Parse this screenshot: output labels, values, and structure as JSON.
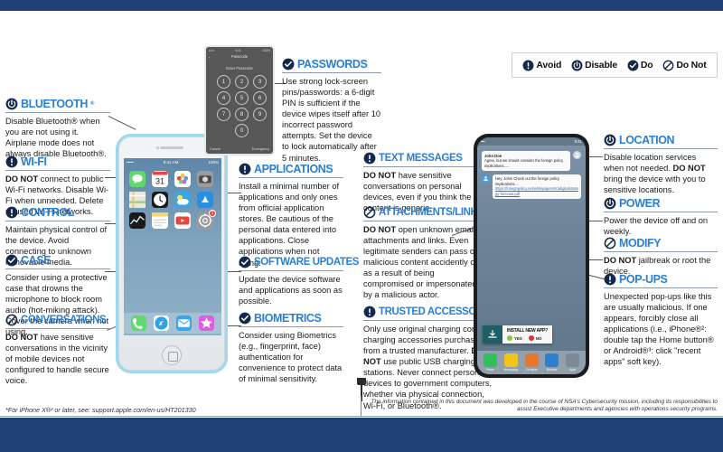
{
  "legend": {
    "items": [
      {
        "icon": "exclamation-icon",
        "label": "Avoid"
      },
      {
        "icon": "power-icon",
        "label": "Disable"
      },
      {
        "icon": "check-icon",
        "label": "Do"
      },
      {
        "icon": "prohibition-icon",
        "label": "Do Not"
      }
    ]
  },
  "sections": {
    "bluetooth": {
      "title": "BLUETOOTH",
      "sup": "®",
      "icon": "power-icon",
      "body": "Disable Bluetooth® when you are not using it. Airplane mode does not always disable Bluetooth®."
    },
    "wifi": {
      "title": "WI-FI",
      "icon": "exclamation-icon",
      "body_bold": "DO NOT",
      "body": " connect to public Wi-Fi networks. Disable Wi-Fi when unneeded. Delete unused Wi-Fi networks."
    },
    "control": {
      "title": "CONTROL",
      "icon": "exclamation-icon",
      "body": "Maintain physical control of the device. Avoid connecting to unknown removable media."
    },
    "case": {
      "title": "CASE",
      "icon": "check-icon",
      "body": "Consider using a protective case that drowns the microphone to block room audio (hot-miking attack). Cover the camera when not using."
    },
    "conversations": {
      "title": "CONVERSATIONS",
      "icon": "prohibition-icon",
      "body_bold": "DO NOT",
      "body": " have sensitive conversations in the vicinity of mobile devices not configured to handle secure voice."
    },
    "passwords": {
      "title": "PASSWORDS",
      "icon": "check-icon",
      "body": "Use strong lock-screen pins/passwords: a 6-digit PIN is sufficient if the device wipes itself after 10 incorrect password attempts. Set the device to lock automatically after 5 minutes."
    },
    "applications": {
      "title": "APPLICATIONS",
      "icon": "exclamation-icon",
      "body": "Install a minimal number of applications and only ones from official application stores. Be cautious of the personal data entered into applications. Close applications when not using."
    },
    "software_updates": {
      "title": "SOFTWARE UPDATES",
      "icon": "check-icon",
      "body": "Update the device software and applications as soon as possible."
    },
    "biometrics": {
      "title": "BIOMETRICS",
      "icon": "check-icon",
      "body": "Consider using Biometrics (e.g., fingerprint, face) authentication for convenience to protect data of minimal sensitivity."
    },
    "text_messages": {
      "title": "TEXT MESSAGES",
      "icon": "exclamation-icon",
      "body_bold": "DO NOT",
      "body": " have sensitive conversations on personal devices, even if you think the content is generic."
    },
    "attachments_links": {
      "title": "ATTACHMENTS/LINKS",
      "icon": "prohibition-icon",
      "body_bold": "DO NOT",
      "body": " open unknown email attachments and links. Even legitimate senders can pass on malicious content accidently or as a result of being compromised or impersonated by a malicious actor."
    },
    "trusted_accessories": {
      "title": "TRUSTED ACCESSORIES",
      "icon": "exclamation-icon",
      "body_pre": "Only use original charging cords or charging accessories purchased from a trusted manufacturer. ",
      "body_bold": "DO NOT",
      "body_post": " use public USB charging stations. Never connect personal devices to government computers, whether via physical connection, Wi-Fi, or Bluetooth®."
    },
    "location": {
      "title": "LOCATION",
      "icon": "power-icon",
      "body_pre": "Disable location services when not needed. ",
      "body_bold": "DO NOT",
      "body_post": " bring the device with you to sensitive locations."
    },
    "power": {
      "title": "POWER",
      "icon": "power-icon",
      "body": "Power the device off and on weekly."
    },
    "modify": {
      "title": "MODIFY",
      "icon": "prohibition-icon",
      "body_bold": "DO NOT",
      "body": " jailbreak or root the device."
    },
    "popups": {
      "title": "POP-UPS",
      "icon": "exclamation-icon",
      "body": "Unexpected pop-ups like this are usually malicious. If one appears, forcibly close all applications (i.e., iPhone®²: double tap the Home button® or Android®³: click \"recent apps\" soft key)."
    }
  },
  "iphone": {
    "status": {
      "left": "•••••",
      "center": "9:41 AM",
      "right": "100%"
    },
    "apps": [
      {
        "name": "messages-app-icon",
        "color": "#5fd96a",
        "glyph": "speech"
      },
      {
        "name": "calendar-app-icon",
        "color": "#ffffff",
        "glyph": "calendar",
        "day": "31"
      },
      {
        "name": "photos-app-icon",
        "color": "#ffffff",
        "glyph": "flower"
      },
      {
        "name": "camera-app-icon",
        "color": "#9b9b9b",
        "glyph": "camera"
      },
      {
        "name": "maps-app-icon",
        "color": "#e9e6dd",
        "glyph": "map"
      },
      {
        "name": "clock-app-icon",
        "color": "#1c1c1c",
        "glyph": "clock"
      },
      {
        "name": "weather-app-icon",
        "color": "#3aa6e8",
        "glyph": "cloud"
      },
      {
        "name": "app-store-app-icon",
        "color": "#2b8fe0",
        "glyph": "appstore"
      },
      {
        "name": "stocks-app-icon",
        "color": "#1a1a1a",
        "glyph": "chart"
      },
      {
        "name": "notes-app-icon",
        "color": "#f5d76e",
        "glyph": "notes"
      },
      {
        "name": "youtube-app-icon",
        "color": "#ffffff",
        "glyph": "play"
      },
      {
        "name": "settings-app-icon",
        "color": "#9a9a9a",
        "glyph": "gear",
        "badge": "1"
      }
    ],
    "dock": [
      {
        "name": "phone-dock-icon",
        "color": "#5fd96a",
        "glyph": "phone"
      },
      {
        "name": "safari-dock-icon",
        "color": "#ffffff",
        "glyph": "compass"
      },
      {
        "name": "mail-dock-icon",
        "color": "#3aa6e8",
        "glyph": "mail"
      },
      {
        "name": "photos-dock-icon",
        "color": "#e05ce0",
        "glyph": "star"
      }
    ]
  },
  "lockscreen": {
    "status_left": "•••••",
    "status_center": "9:41",
    "status_right": "100%",
    "back": "‹",
    "title": "Passcode",
    "prompt": "Enter Passcode",
    "keys": [
      "1",
      "2",
      "3",
      "4",
      "5",
      "6",
      "7",
      "8",
      "9",
      "0"
    ],
    "foot_left": "Cancel",
    "foot_right": "Emergency"
  },
  "android": {
    "status_left": "•••",
    "status_right": "9:41",
    "messages": [
      {
        "sender": "John Doe",
        "text": "Agree, but we should consider the foreign policy implications.....",
        "side": "left"
      },
      {
        "sender": "",
        "text": "Hey, John! Check out the foreign policy implications...",
        "link": "https://foriegnpolicy.net/whitepapers/tradigitalstrategy-forecast.pdf",
        "side": "right"
      }
    ],
    "popup": {
      "icon": "download-icon",
      "title": "INSTALL NEW APP?",
      "yes": "YES",
      "yes_color": "#8dc63f",
      "no": "NO",
      "no_color": "#d8352a"
    },
    "dock": [
      {
        "name": "phone-dock-icon",
        "label": "Phone",
        "color": "#2fbf5b"
      },
      {
        "name": "messaging-dock-icon",
        "label": "Messaging",
        "color": "#f0c419"
      },
      {
        "name": "contacts-dock-icon",
        "label": "Contacts",
        "color": "#e8762c"
      },
      {
        "name": "browser-dock-icon",
        "label": "Browser",
        "color": "#2f7fd0"
      },
      {
        "name": "apps-dock-icon",
        "label": "Apps",
        "color": "#7c8a98"
      }
    ]
  },
  "footer": {
    "footnote": "*For iPhone X®² or later, see: support.apple.com/en-us/HT201330",
    "disclaimer": "The information contained in this document was developed in the course of NSA's Cybersecurity mission, including its responsibilities to assist Executive departments and agencies with operations security programs."
  }
}
